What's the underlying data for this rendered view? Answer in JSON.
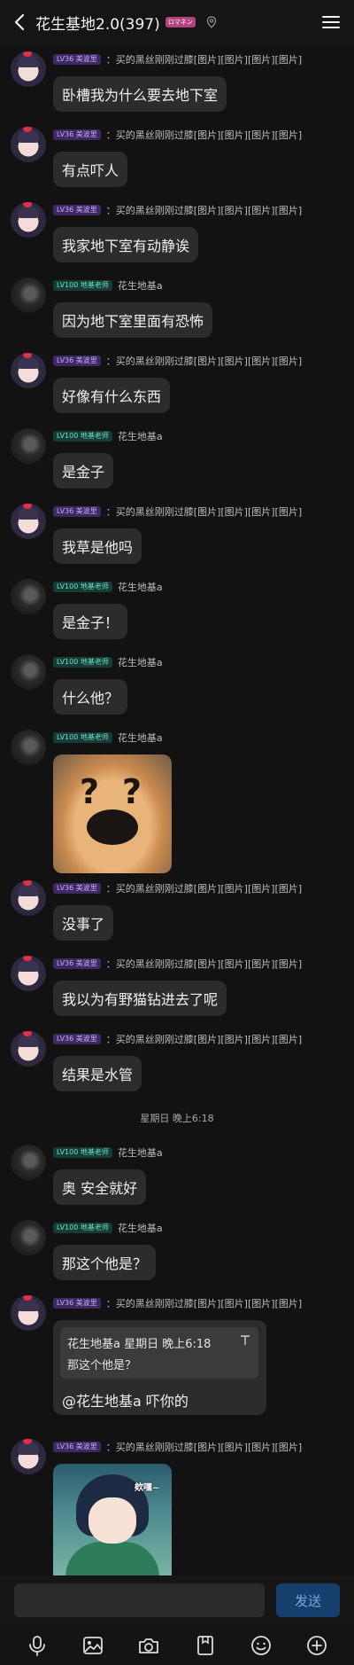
{
  "header": {
    "title": "花生基地2.0(397)",
    "badge": "ロマネン"
  },
  "messages": [
    {
      "avatar": "girl",
      "badge": "LV36 美波里",
      "badge_color": "purple",
      "nick": "：买的黑丝刚刚过膝[图片][图片][图片][图片]",
      "text": "卧槽我为什么要去地下室"
    },
    {
      "avatar": "girl",
      "badge": "LV36 美波里",
      "badge_color": "purple",
      "nick": "：买的黑丝刚刚过膝[图片][图片][图片][图片]",
      "text": "有点吓人"
    },
    {
      "avatar": "girl",
      "badge": "LV36 美波里",
      "badge_color": "purple",
      "nick": "：买的黑丝刚刚过膝[图片][图片][图片][图片]",
      "text": "我家地下室有动静诶"
    },
    {
      "avatar": "dark",
      "badge": "LV100 地基老师",
      "badge_color": "green",
      "nick": "花生地基a",
      "text": "因为地下室里面有恐怖"
    },
    {
      "avatar": "girl",
      "badge": "LV36 美波里",
      "badge_color": "purple",
      "nick": "：买的黑丝刚刚过膝[图片][图片][图片][图片]",
      "text": "好像有什么东西"
    },
    {
      "avatar": "dark",
      "badge": "LV100 地基老师",
      "badge_color": "green",
      "nick": "花生地基a",
      "text": "是金子"
    },
    {
      "avatar": "girl",
      "badge": "LV36 美波里",
      "badge_color": "purple",
      "nick": "：买的黑丝刚刚过膝[图片][图片][图片][图片]",
      "text": "我草是他吗"
    },
    {
      "avatar": "dark",
      "badge": "LV100 地基老师",
      "badge_color": "green",
      "nick": "花生地基a",
      "text": "是金子！"
    },
    {
      "avatar": "dark",
      "badge": "LV100 地基老师",
      "badge_color": "green",
      "nick": "花生地基a",
      "text": "什么他？"
    },
    {
      "avatar": "dark",
      "badge": "LV100 地基老师",
      "badge_color": "green",
      "nick": "花生地基a",
      "image": "doge",
      "image_text": "? ?"
    },
    {
      "avatar": "girl",
      "badge": "LV36 美波里",
      "badge_color": "purple",
      "nick": "：买的黑丝刚刚过膝[图片][图片][图片][图片]",
      "text": "没事了"
    },
    {
      "avatar": "girl",
      "badge": "LV36 美波里",
      "badge_color": "purple",
      "nick": "：买的黑丝刚刚过膝[图片][图片][图片][图片]",
      "text": "我以为有野猫钻进去了呢"
    },
    {
      "avatar": "girl",
      "badge": "LV36 美波里",
      "badge_color": "purple",
      "nick": "：买的黑丝刚刚过膝[图片][图片][图片][图片]",
      "text": "结果是水管"
    },
    {
      "avatar": "dark",
      "badge": "LV100 地基老师",
      "badge_color": "green",
      "nick": "花生地基a",
      "text": "奥 安全就好"
    },
    {
      "avatar": "dark",
      "badge": "LV100 地基老师",
      "badge_color": "green",
      "nick": "花生地基a",
      "text": "那这个他是？"
    },
    {
      "avatar": "girl",
      "badge": "LV36 美波里",
      "badge_color": "purple",
      "nick": "：买的黑丝刚刚过膝[图片][图片][图片][图片]",
      "reply": {
        "quote_head": "花生地基a 星期日 晚上6:18",
        "quote_body": "那这个他是？",
        "text": "@花生地基a 吓你的"
      }
    },
    {
      "avatar": "girl",
      "badge": "LV36 美波里",
      "badge_color": "purple",
      "nick": "：买的黑丝刚刚过膝[图片][图片][图片][图片]",
      "image": "venti",
      "image_text": "欸嘿~"
    }
  ],
  "time_separator": "星期日 晚上6:18",
  "input": {
    "placeholder": "",
    "send_label": "发送"
  },
  "toolbar": [
    "mic-icon",
    "image-icon",
    "camera-icon",
    "file-icon",
    "emoji-icon",
    "plus-icon"
  ],
  "colors": {
    "background": "#121212",
    "bubble": "#2c2c2e",
    "send": "#173f6e",
    "badge_purple": "#3e2a63",
    "badge_green": "#163c35"
  }
}
